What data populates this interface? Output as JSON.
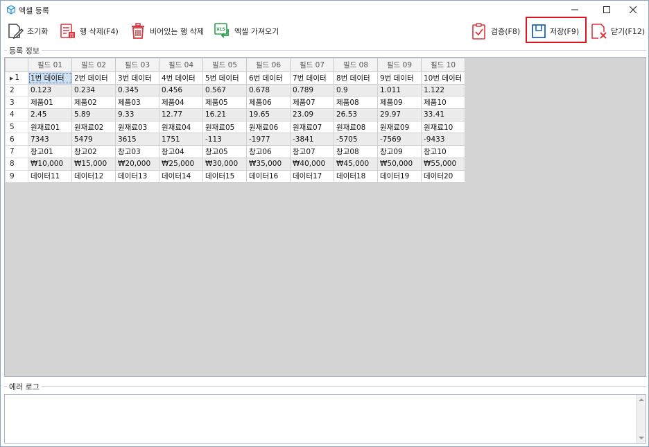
{
  "window": {
    "title": "엑셀 등록",
    "minimize": "—",
    "maximize": "☐",
    "close": "✕"
  },
  "toolbar": {
    "reset_label": "조기화",
    "delete_row_label": "행 삭제(F4)",
    "delete_empty_label": "비어있는 행 삭제",
    "import_excel_label": "엑셀 가져오기",
    "import_icon_text": "XLS",
    "validate_label": "검증(F8)",
    "save_label": "저장(F9)",
    "close_label": "닫기(F12)"
  },
  "colors": {
    "accent_red": "#e0141e",
    "icon_blue": "#1d62b4",
    "icon_green": "#2e9b4f",
    "icon_red": "#d9363e"
  },
  "groups": {
    "registration": "등록 정보",
    "error_log": "에러 로그"
  },
  "grid": {
    "columns": [
      "필드 01",
      "필드 02",
      "필드 03",
      "필드 04",
      "필드 05",
      "필드 06",
      "필드 07",
      "필드 08",
      "필드 09",
      "필드 10"
    ],
    "rows": [
      {
        "num": "1",
        "cells": [
          "1번 데이터",
          "2번 데이터",
          "3번 데이터",
          "4번 데이터",
          "5번 데이터",
          "6번 데이터",
          "7번 데이터",
          "8번 데이터",
          "9번 데이터",
          "10번 데이터"
        ]
      },
      {
        "num": "2",
        "cells": [
          "0.123",
          "0.234",
          "0.345",
          "0.456",
          "0.567",
          "0.678",
          "0.789",
          "0.9",
          "1.011",
          "1.122"
        ]
      },
      {
        "num": "3",
        "cells": [
          "제품01",
          "제품02",
          "제품03",
          "제품04",
          "제품05",
          "제품06",
          "제품07",
          "제품08",
          "제품09",
          "제품10"
        ]
      },
      {
        "num": "4",
        "cells": [
          "2.45",
          "5.89",
          "9.33",
          "12.77",
          "16.21",
          "19.65",
          "23.09",
          "26.53",
          "29.97",
          "33.41"
        ]
      },
      {
        "num": "5",
        "cells": [
          "원재료01",
          "원재료02",
          "원재료03",
          "원재료04",
          "원재료05",
          "원재료06",
          "원재료07",
          "원재료08",
          "원재료09",
          "원재료10"
        ]
      },
      {
        "num": "6",
        "cells": [
          "7343",
          "5479",
          "3615",
          "1751",
          "-113",
          "-1977",
          "-3841",
          "-5705",
          "-7569",
          "-9433"
        ]
      },
      {
        "num": "7",
        "cells": [
          "창고01",
          "창고02",
          "창고03",
          "창고04",
          "창고05",
          "창고06",
          "창고07",
          "창고08",
          "창고09",
          "창고10"
        ]
      },
      {
        "num": "8",
        "cells": [
          "₩10,000",
          "₩15,000",
          "₩20,000",
          "₩25,000",
          "₩30,000",
          "₩35,000",
          "₩40,000",
          "₩45,000",
          "₩50,000",
          "₩55,000"
        ]
      },
      {
        "num": "9",
        "cells": [
          "데이터11",
          "데이터12",
          "데이터13",
          "데이터14",
          "데이터15",
          "데이터16",
          "데이터17",
          "데이터18",
          "데이터19",
          "데이터20"
        ]
      }
    ],
    "current_row_marker": "▶"
  },
  "error_log": {
    "text": ""
  }
}
